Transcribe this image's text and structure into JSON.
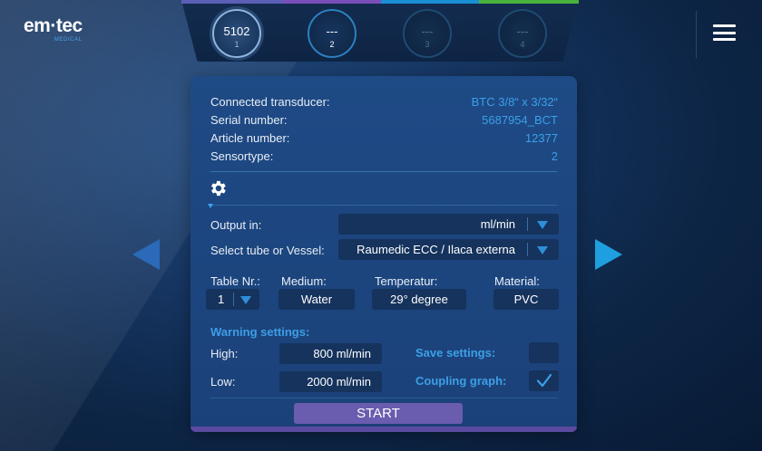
{
  "brand": {
    "name": "em·tec",
    "tagline": "MEDICAL"
  },
  "channels": [
    {
      "value": "5102",
      "number": "1",
      "state": "active"
    },
    {
      "value": "---",
      "number": "2",
      "state": "connected"
    },
    {
      "value": "---",
      "number": "3",
      "state": "inactive"
    },
    {
      "value": "---",
      "number": "4",
      "state": "inactive"
    }
  ],
  "channel_colors": [
    "#5b5fb5",
    "#7a4db8",
    "#1a8fd6",
    "#49b23a"
  ],
  "transducer": {
    "connected_label": "Connected transducer:",
    "connected_value": "BTC 3/8“ x 3/32“",
    "serial_label": "Serial number:",
    "serial_value": "5687954_BCT",
    "article_label": "Article number:",
    "article_value": "12377",
    "sensortype_label": "Sensortype:",
    "sensortype_value": "2"
  },
  "settings": {
    "output_label": "Output in:",
    "output_value": "ml/min",
    "tube_label": "Select tube or Vessel:",
    "tube_value": "Raumedic ECC / Ilaca externa",
    "table_label": "Table Nr.:",
    "table_value": "1",
    "medium_label": "Medium:",
    "medium_value": "Water",
    "temperatur_label": "Temperatur:",
    "temperatur_value": "29° degree",
    "material_label": "Material:",
    "material_value": "PVC"
  },
  "warning": {
    "heading": "Warning settings:",
    "high_label": "High:",
    "high_value": "800 ml/min",
    "low_label": "Low:",
    "low_value": "2000 ml/min",
    "save_label": "Save settings:",
    "save_checked": false,
    "coupling_label": "Coupling graph:",
    "coupling_checked": true
  },
  "start_label": "START",
  "icons": {
    "settings": "gear-icon",
    "menu": "hamburger-menu-icon",
    "prev": "arrow-left-icon",
    "next": "arrow-right-icon"
  },
  "accent_color": "#3aa0e8"
}
